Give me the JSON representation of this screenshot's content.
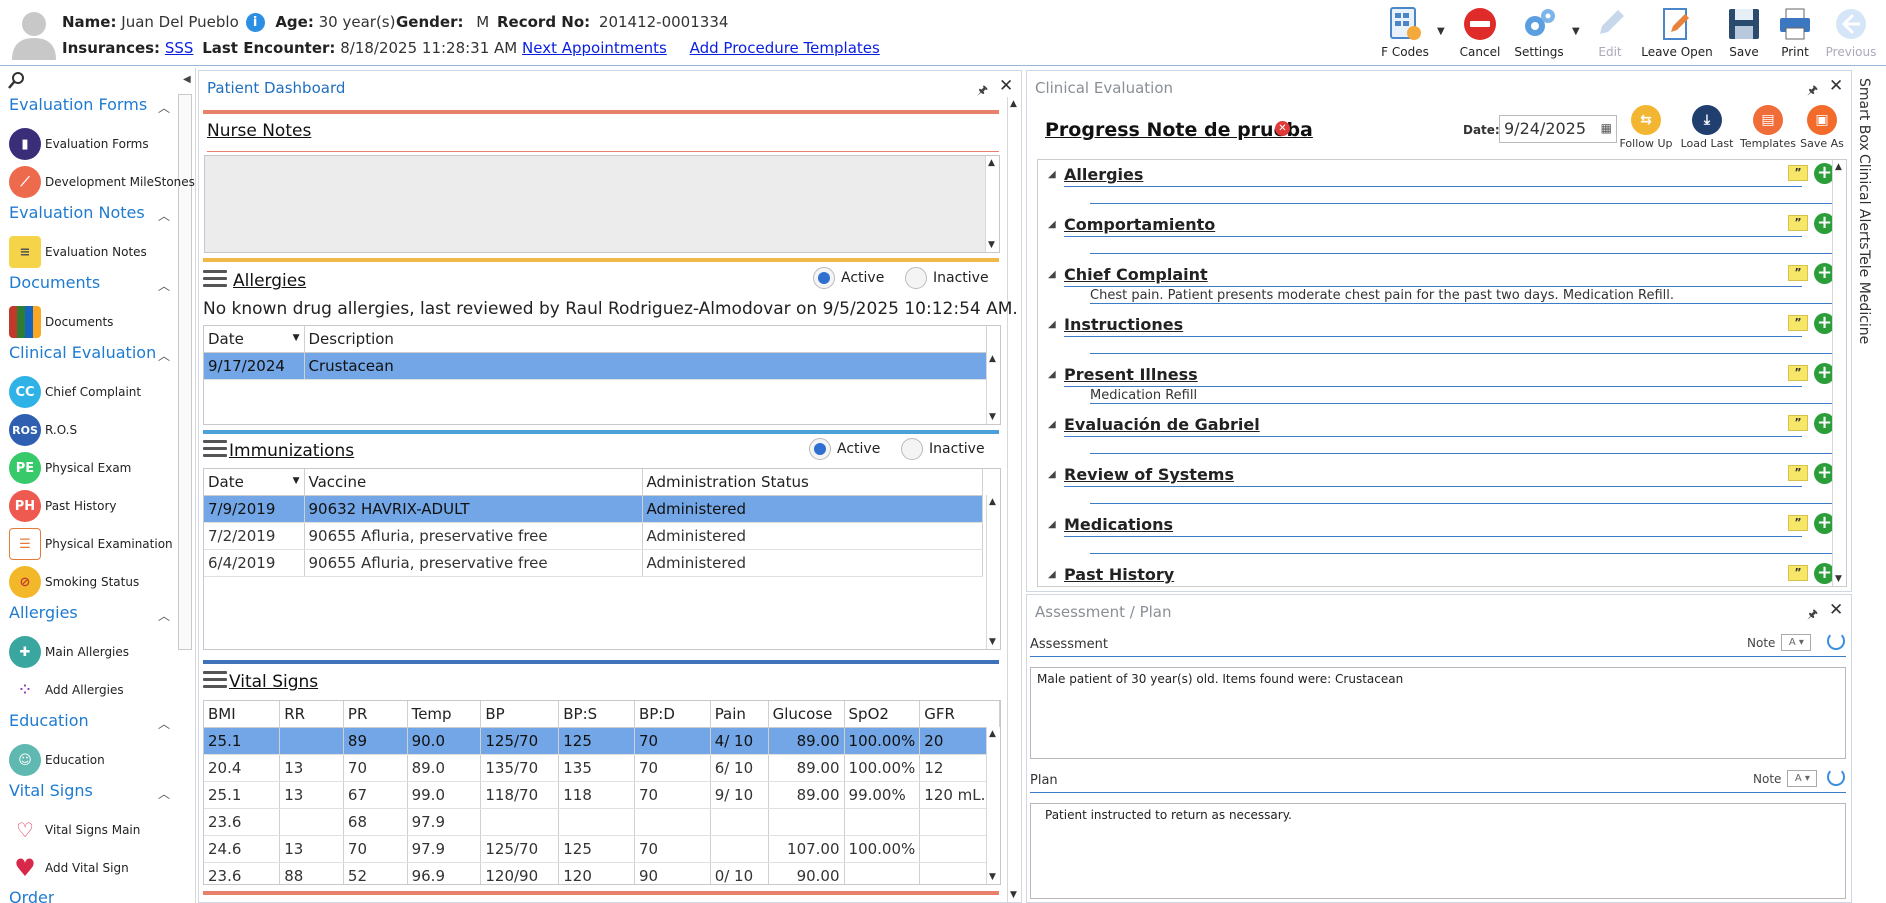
{
  "header": {
    "name_label": "Name:",
    "name": "Juan Del Pueblo",
    "age_label": "Age:",
    "age": "30 year(s)",
    "gender_label": "Gender:",
    "gender": "M",
    "record_label": "Record No:",
    "record": "201412-0001334",
    "insurances_label": "Insurances:",
    "insurance": "SSS",
    "last_encounter_label": "Last Encounter:",
    "last_encounter": "8/18/2025 11:28:31 AM",
    "next_appointments": "Next Appointments",
    "add_procedure_templates": "Add Procedure Templates",
    "info_glyph": "i"
  },
  "toolbar": {
    "fcodes": "F Codes",
    "cancel": "Cancel",
    "settings": "Settings",
    "edit": "Edit",
    "leave_open": "Leave Open",
    "save": "Save",
    "print": "Print",
    "previous": "Previous"
  },
  "sidebar": {
    "evaluation_forms": "Evaluation Forms",
    "evaluation_forms_items": [
      "Evaluation Forms",
      "Development MileStones"
    ],
    "evaluation_notes": "Evaluation Notes",
    "evaluation_notes_items": [
      "Evaluation Notes"
    ],
    "documents": "Documents",
    "documents_items": [
      "Documents"
    ],
    "clinical_evaluation": "Clinical Evaluation",
    "clinical_evaluation_items": [
      "Chief Complaint",
      "R.O.S",
      "Physical Exam",
      "Past History",
      "Physical Examination",
      "Smoking Status"
    ],
    "clinical_icons": [
      "CC",
      "ROS",
      "PE",
      "PH"
    ],
    "allergies": "Allergies",
    "allergies_items": [
      "Main Allergies",
      "Add Allergies"
    ],
    "education": "Education",
    "education_items": [
      "Education"
    ],
    "vital_signs": "Vital Signs",
    "vital_signs_items": [
      "Vital Signs Main",
      "Add Vital Sign"
    ],
    "order": "Order"
  },
  "dashboard": {
    "title": "Patient Dashboard",
    "nurse_notes": "Nurse Notes",
    "allergies_title": "Allergies",
    "active": "Active",
    "inactive": "Inactive",
    "allergy_message": "No known drug allergies, last reviewed by Raul Rodriguez-Almodovar on 9/5/2025 10:12:54 AM.",
    "allergy_headers": [
      "Date",
      "Description"
    ],
    "allergy_rows": [
      [
        "9/17/2024",
        "Crustacean"
      ]
    ],
    "immunizations_title": "Immunizations",
    "immunization_headers": [
      "Date",
      "Vaccine",
      "Administration Status"
    ],
    "immunization_rows": [
      [
        "7/9/2019",
        "90632 HAVRIX-ADULT",
        "Administered"
      ],
      [
        "7/2/2019",
        "90655 Afluria, preservative free",
        "Administered"
      ],
      [
        "6/4/2019",
        "90655 Afluria, preservative free",
        "Administered"
      ]
    ],
    "vitals_title": "Vital Signs",
    "vital_headers": [
      "BMI",
      "RR",
      "PR",
      "Temp",
      "BP",
      "BP:S",
      "BP:D",
      "Pain",
      "Glucose",
      "SpO2",
      "GFR"
    ],
    "vital_rows": [
      [
        "25.1",
        "",
        "89",
        "90.0",
        "125/70",
        "125",
        "70",
        "4/ 10",
        "89.00",
        "100.00%",
        "20"
      ],
      [
        "20.4",
        "13",
        "70",
        "89.0",
        "135/70",
        "135",
        "70",
        "6/ 10",
        "89.00",
        "100.00%",
        "12"
      ],
      [
        "25.1",
        "13",
        "67",
        "99.0",
        "118/70",
        "118",
        "70",
        "9/ 10",
        "89.00",
        "99.00%",
        "120 mL..."
      ],
      [
        "23.6",
        "",
        "68",
        "97.9",
        "",
        "",
        "",
        "",
        "",
        "",
        ""
      ],
      [
        "24.6",
        "13",
        "70",
        "97.9",
        "125/70",
        "125",
        "70",
        "",
        "107.00",
        "100.00%",
        ""
      ],
      [
        "23.6",
        "88",
        "52",
        "96.9",
        "120/90",
        "120",
        "90",
        "0/ 10",
        "90.00",
        "",
        ""
      ]
    ]
  },
  "clinical": {
    "title": "Clinical Evaluation",
    "note_title": "Progress Note de prueba",
    "date_label": "Date:",
    "date": "9/24/2025",
    "tools": [
      "Follow Up",
      "Load Last",
      "Templates",
      "Save As"
    ],
    "quote_glyph": "”",
    "sections": [
      {
        "label": "Allergies",
        "text": ""
      },
      {
        "label": "Comportamiento",
        "text": ""
      },
      {
        "label": "Chief Complaint",
        "text": "Chest pain. Patient presents moderate chest pain for the past two days. Medication Refill."
      },
      {
        "label": "Instructiones",
        "text": ""
      },
      {
        "label": "Present Illness",
        "text": "Medication Refill"
      },
      {
        "label": "Evaluación de Gabriel",
        "text": ""
      },
      {
        "label": "Review of Systems",
        "text": ""
      },
      {
        "label": "Medications",
        "text": ""
      },
      {
        "label": "Past History",
        "text": ""
      }
    ]
  },
  "assessment": {
    "title": "Assessment / Plan",
    "assessment_label": "Assessment",
    "note_label": "Note",
    "assessment_text": "Male patient of 30 year(s) old. Items found were:  Crustacean",
    "plan_label": "Plan",
    "plan_text": "Patient instructed to return as necessary."
  },
  "right_tabs": [
    "Smart Box",
    "Clinical Alerts",
    "Tele Medicine"
  ]
}
